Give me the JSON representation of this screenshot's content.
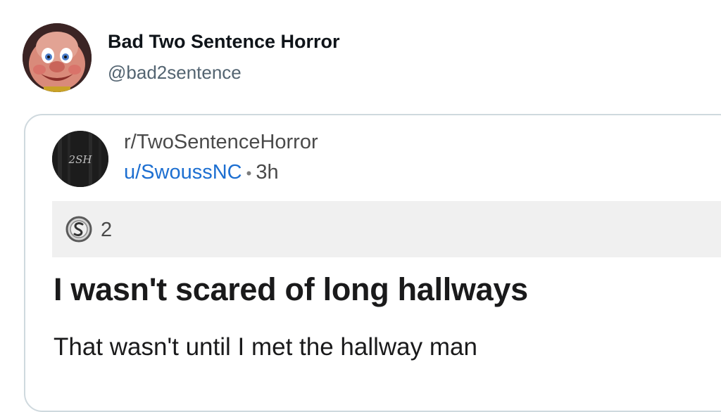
{
  "tweet": {
    "display_name": "Bad Two Sentence Horror",
    "handle": "@bad2sentence"
  },
  "reddit_post": {
    "subreddit": "r/TwoSentenceHorror",
    "avatar_text": "2SH",
    "username": "u/SwoussNC",
    "separator": "•",
    "age": "3h",
    "award_count": "2",
    "title": "I wasn't scared of long hallways",
    "body": "That wasn't until I met the hallway man"
  },
  "colors": {
    "username_link": "#1d6fd1",
    "card_border": "#cfd9de",
    "award_bar_bg": "#f0f0f0"
  }
}
